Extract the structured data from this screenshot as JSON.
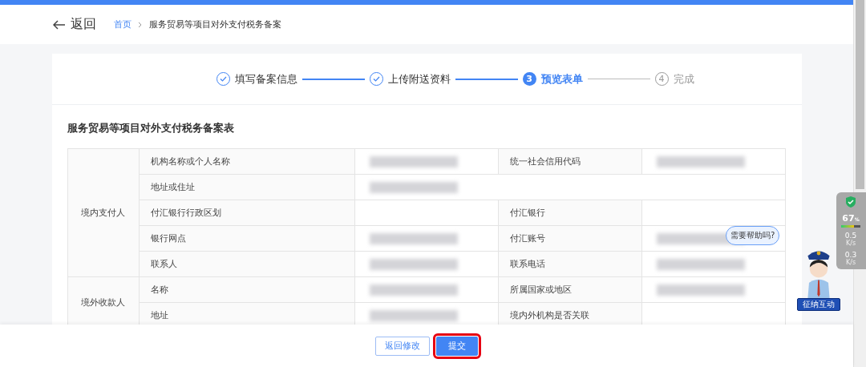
{
  "header": {
    "back": "返回",
    "breadcrumb": [
      {
        "label": "首页",
        "link": true
      },
      {
        "label": "服务贸易等项目对外支付税务备案",
        "link": false
      }
    ]
  },
  "steps": [
    {
      "label": "填写备案信息",
      "checked": true,
      "selected": false
    },
    {
      "label": "上传附送资料",
      "checked": true,
      "selected": false
    },
    {
      "number": "3",
      "label": "预览表单",
      "checked": false,
      "selected": true
    },
    {
      "number": "4",
      "label": "完成",
      "checked": false,
      "selected": false
    }
  ],
  "form_title": "服务贸易等项目对外支付税务备案表",
  "table": {
    "groups": [
      {
        "label": "境内支付人",
        "rows": [
          {
            "cells": [
              {
                "label": "机构名称或个人名称",
                "redacted": true
              },
              {
                "label": "统一社会信用代码",
                "redacted": true
              }
            ]
          },
          {
            "cells": [
              {
                "label": "地址或住址",
                "redacted": true
              }
            ]
          },
          {
            "cells": [
              {
                "label": "付汇银行行政区划"
              },
              {
                "label": "付汇银行"
              }
            ]
          },
          {
            "cells": [
              {
                "label": "银行网点",
                "redacted": true
              },
              {
                "label": "付汇账号",
                "redacted": true
              }
            ]
          },
          {
            "cells": [
              {
                "label": "联系人",
                "redacted": true
              },
              {
                "label": "联系电话",
                "redacted": true
              }
            ]
          }
        ]
      },
      {
        "label": "境外收款人",
        "rows": [
          {
            "cells": [
              {
                "label": "名称",
                "redacted": true
              },
              {
                "label": "所属国家或地区",
                "redacted": true
              }
            ]
          },
          {
            "cells": [
              {
                "label": "地址",
                "redacted": true
              },
              {
                "label": "境内外机构是否关联"
              }
            ]
          }
        ]
      }
    ]
  },
  "buttons": [
    {
      "label": "返回修改",
      "kind": "secondary",
      "highlighted": false
    },
    {
      "label": "提交",
      "kind": "primary",
      "highlighted": true
    }
  ],
  "monitor": {
    "percent": "67",
    "unit": "%",
    "level": 0.67,
    "upload": "0.5",
    "upload_unit": "K/s",
    "download": "0.3",
    "download_unit": "K/s"
  },
  "assistant": {
    "bubble": "需要帮助吗?",
    "banner": "征纳互动"
  }
}
